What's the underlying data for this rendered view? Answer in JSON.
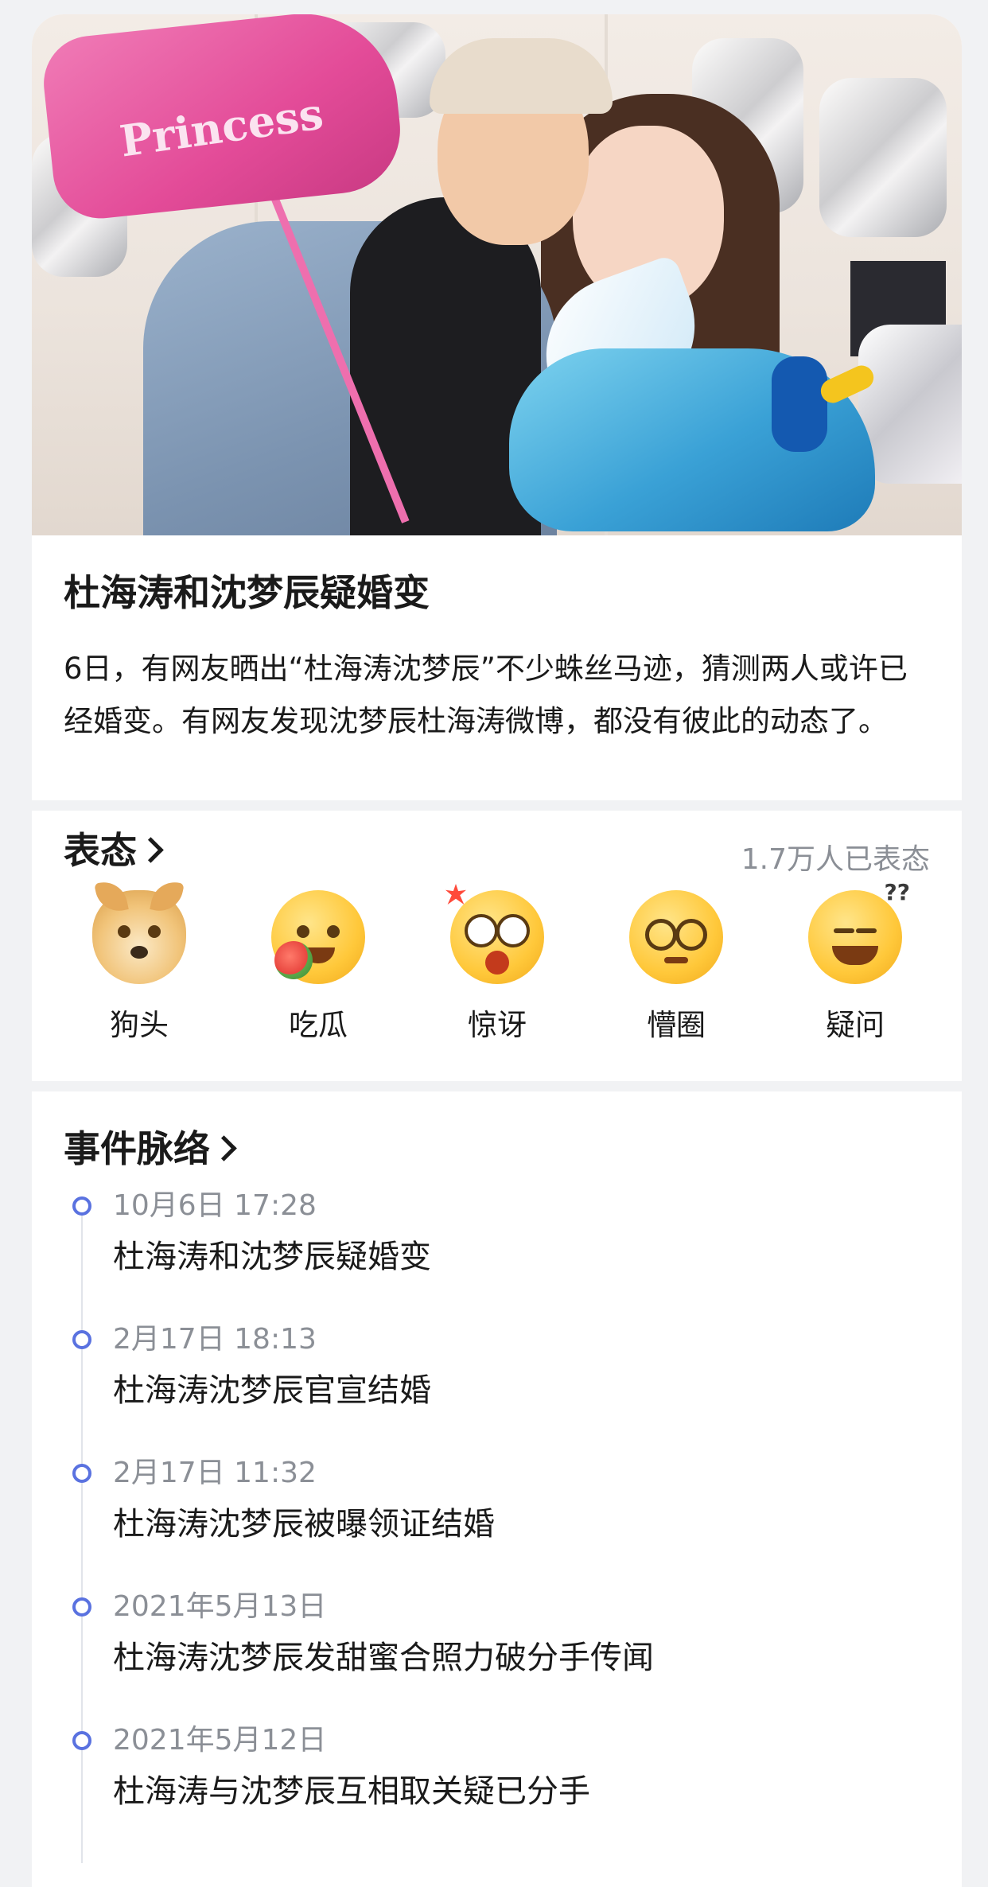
{
  "news": {
    "title": "杜海涛和沈梦辰疑婚变",
    "description": "6日，有网友晒出“杜海涛沈梦辰”不少蛛丝马迹，猜测两人或许已经婚变。有网友发现沈梦辰杜海涛微博，都没有彼此的动态了。",
    "image_balloon_text": "Princess"
  },
  "reactions": {
    "title": "表态",
    "count": "1.7万人已表态",
    "items": [
      {
        "label": "狗头",
        "icon": "doge-emoji-icon"
      },
      {
        "label": "吃瓜",
        "icon": "eating-melon-emoji-icon"
      },
      {
        "label": "惊讶",
        "icon": "surprised-emoji-icon"
      },
      {
        "label": "懵圈",
        "icon": "dizzy-emoji-icon"
      },
      {
        "label": "疑问",
        "icon": "puzzled-emoji-icon"
      }
    ]
  },
  "timeline": {
    "title": "事件脉络",
    "events": [
      {
        "date": "10月6日 17:28",
        "text": "杜海涛和沈梦辰疑婚变"
      },
      {
        "date": "2月17日 18:13",
        "text": "杜海涛沈梦辰官宣结婚"
      },
      {
        "date": "2月17日 11:32",
        "text": "杜海涛沈梦辰被曝领证结婚"
      },
      {
        "date": "2021年5月13日",
        "text": "杜海涛沈梦辰发甜蜜合照力破分手传闻"
      },
      {
        "date": "2021年5月12日",
        "text": "杜海涛与沈梦辰互相取关疑已分手"
      }
    ]
  },
  "colors": {
    "timeline_dot": "#5a72e0",
    "muted_text": "#8b8f96",
    "background": "#f1f2f4"
  }
}
